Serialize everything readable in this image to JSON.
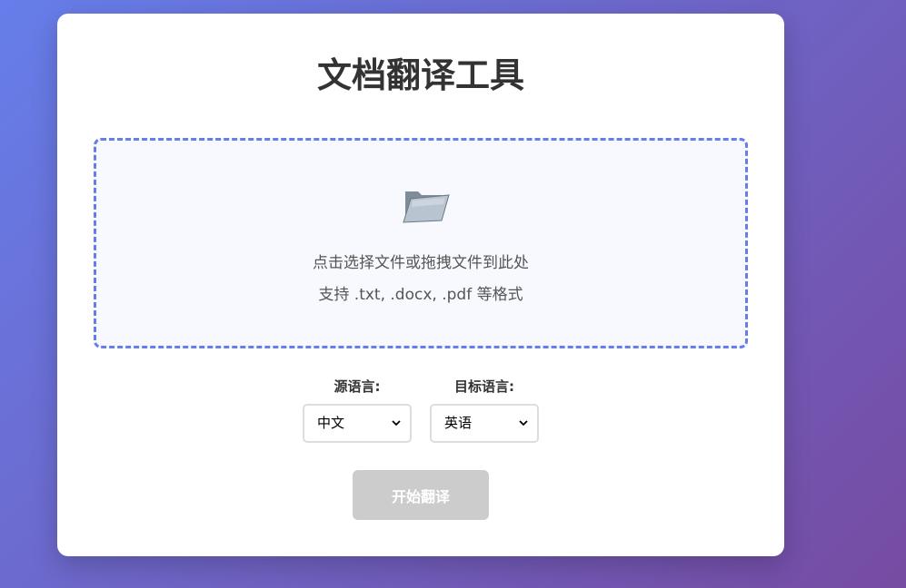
{
  "app": {
    "title": "文档翻译工具"
  },
  "upload": {
    "icon": "folder-icon",
    "prompt": "点击选择文件或拖拽文件到此处",
    "formats": "支持 .txt, .docx, .pdf 等格式"
  },
  "source_language": {
    "label": "源语言:",
    "selected": "中文"
  },
  "target_language": {
    "label": "目标语言:",
    "selected": "英语"
  },
  "action": {
    "translate_label": "开始翻译",
    "enabled": false
  },
  "colors": {
    "accent": "#667eea",
    "background_start": "#667eea",
    "background_end": "#764ba2",
    "button_disabled": "#cccccc"
  }
}
